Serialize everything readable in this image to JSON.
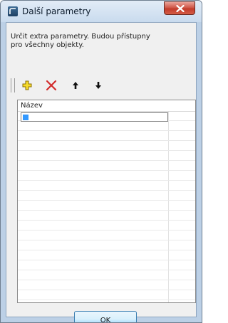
{
  "window": {
    "title": "Další parametry",
    "close_icon": "close-icon"
  },
  "description": {
    "line1": "Určit extra parametry. Budou přístupny",
    "line2": "pro všechny objekty."
  },
  "toolbar": {
    "buttons": [
      {
        "name": "add-icon",
        "color": "#f2d01c"
      },
      {
        "name": "delete-icon",
        "color": "#d22b2b"
      },
      {
        "name": "move-up-icon",
        "color": "#111111"
      },
      {
        "name": "move-down-icon",
        "color": "#111111"
      }
    ]
  },
  "grid": {
    "columns": [
      "Název"
    ],
    "rows": [
      ""
    ]
  },
  "buttons": {
    "ok_label": "OK"
  }
}
